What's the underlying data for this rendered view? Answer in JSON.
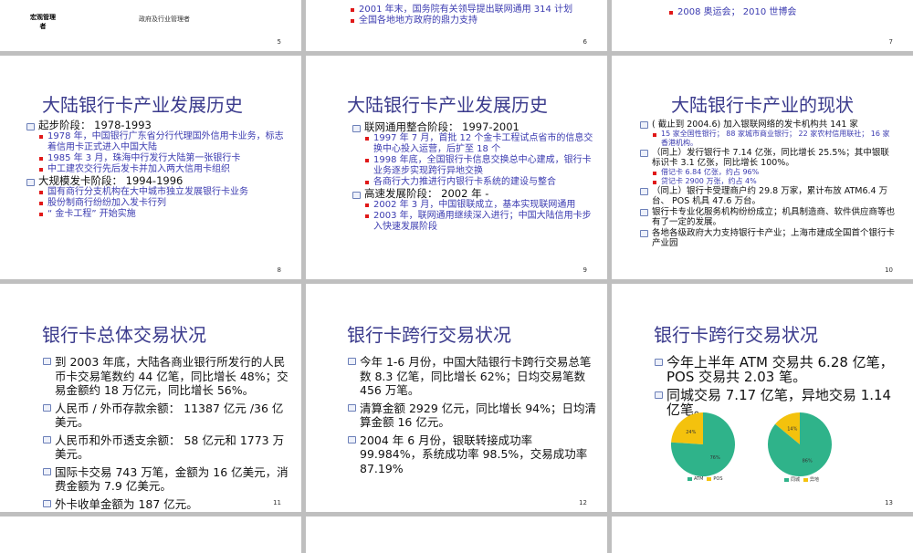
{
  "slides": {
    "s5": {
      "number": "5",
      "author": "宏观管理者",
      "text": "政府及行业管理者"
    },
    "s6": {
      "number": "6",
      "items": [
        "2001 年末，国务院有关领导提出联网通用 314 计划",
        "全国各地地方政府的鼎力支持"
      ]
    },
    "s7": {
      "number": "7",
      "items": [
        "2008 奥运会； 2010 世博会"
      ]
    },
    "s8": {
      "number": "8",
      "title": "大陆银行卡产业发展历史",
      "stages": [
        {
          "label": "起步阶段： 1978-1993",
          "items": [
            "1978 年，中国银行广东省分行代理国外信用卡业务，标志着信用卡正式进入中国大陆",
            "1985 年 3 月，珠海中行发行大陆第一张银行卡",
            "中工建农交行先后发卡并加入两大信用卡组织"
          ]
        },
        {
          "label": "大规模发卡阶段： 1994-1996",
          "items": [
            "国有商行分支机构在大中城市独立发展银行卡业务",
            "股份制商行纷纷加入发卡行列",
            "“ 金卡工程” 开始实施"
          ]
        }
      ]
    },
    "s9": {
      "number": "9",
      "title": "大陆银行卡产业发展历史",
      "stages": [
        {
          "label": "联网通用整合阶段： 1997-2001",
          "items": [
            "1997 年 7 月，首批 12 个金卡工程试点省市的信息交换中心投入运营，后扩至 18 个",
            "1998 年底，全国银行卡信息交换总中心建成，银行卡业务逐步实现跨行异地交换",
            "各商行大力推进行内银行卡系统的建设与整合"
          ]
        },
        {
          "label": "高速发展阶段： 2002 年 -",
          "items": [
            "2002 年 3 月，中国银联成立，基本实现联网通用",
            "2003 年，联网通用继续深入进行；中国大陆信用卡步入快速发展阶段"
          ]
        }
      ]
    },
    "s10": {
      "number": "10",
      "title": "大陆银行卡产业的现状",
      "items": [
        {
          "label": "( 截止到 2004.6) 加入银联网络的发卡机构共 141 家",
          "sub": [
            "15 家全国性银行； 88 家城市商业银行； 22 家农村信用联社； 16 家香港机构。"
          ]
        },
        {
          "label": "（同上）发行银行卡 7.14 亿张，同比增长 25.5%；其中银联标识卡 3.1 亿张，同比增长 100%。",
          "sub": [
            "借记卡 6.84 亿张，约占 96%",
            "贷记卡 2900 万张，约占 4%"
          ]
        },
        {
          "label": "（同上）银行卡受理商户约 29.8 万家，累计布放 ATM6.4 万台、 POS 机具 47.6 万台。",
          "sub": []
        },
        {
          "label": "银行卡专业化服务机构纷纷成立；机具制造商、软件供应商等也有了一定的发展。",
          "sub": []
        },
        {
          "label": "各地各级政府大力支持银行卡产业；上海市建成全国首个银行卡产业园",
          "sub": []
        }
      ]
    },
    "s11": {
      "number": "11",
      "title": "银行卡总体交易状况",
      "items": [
        "到 2003 年底，大陆各商业银行所发行的人民币卡交易笔数约 44 亿笔，同比增长 48%；交易金额约 18 万亿元，同比增长 56%。",
        "人民币 / 外币存款余额： 11387 亿元 /36 亿美元。",
        "人民币和外币透支余额： 58 亿元和 1773 万美元。",
        "国际卡交易 743 万笔，金额为 16 亿美元，消费金额为 7.9 亿美元。",
        "外卡收单金额为 187 亿元。"
      ]
    },
    "s12": {
      "number": "12",
      "title": "银行卡跨行交易状况",
      "items": [
        "今年 1-6 月份，中国大陆银行卡跨行交易总笔数 8.3 亿笔，同比增长 62%；日均交易笔数 456 万笔。",
        "清算金额 2929 亿元，同比增长 94%；日均清算金额 16 亿元。",
        "2004 年 6 月份，银联转接成功率 99.984%，系统成功率 98.5%，交易成功率 87.19%"
      ]
    },
    "s13": {
      "number": "13",
      "title": "银行卡跨行交易状况",
      "items": [
        "今年上半年 ATM 交易共 6.28 亿笔， POS 交易共 2.03 笔。",
        "同城交易 7.17 亿笔，异地交易 1.14 亿笔。"
      ]
    }
  },
  "chart_data": [
    {
      "type": "pie",
      "categories": [
        "ATM",
        "POS"
      ],
      "values": [
        76,
        24
      ],
      "data_labels": [
        "76%",
        "24%"
      ],
      "legend": "bottom"
    },
    {
      "type": "pie",
      "categories": [
        "同城",
        "异地"
      ],
      "values": [
        86,
        14
      ],
      "data_labels": [
        "86%",
        "14%"
      ],
      "legend": "bottom"
    }
  ],
  "colors": {
    "green": "#2fb38a",
    "yellow": "#f4c20d",
    "title": "#3a3a8c",
    "bullet_red": "#e01818",
    "sub_text": "#3b3bb0"
  }
}
